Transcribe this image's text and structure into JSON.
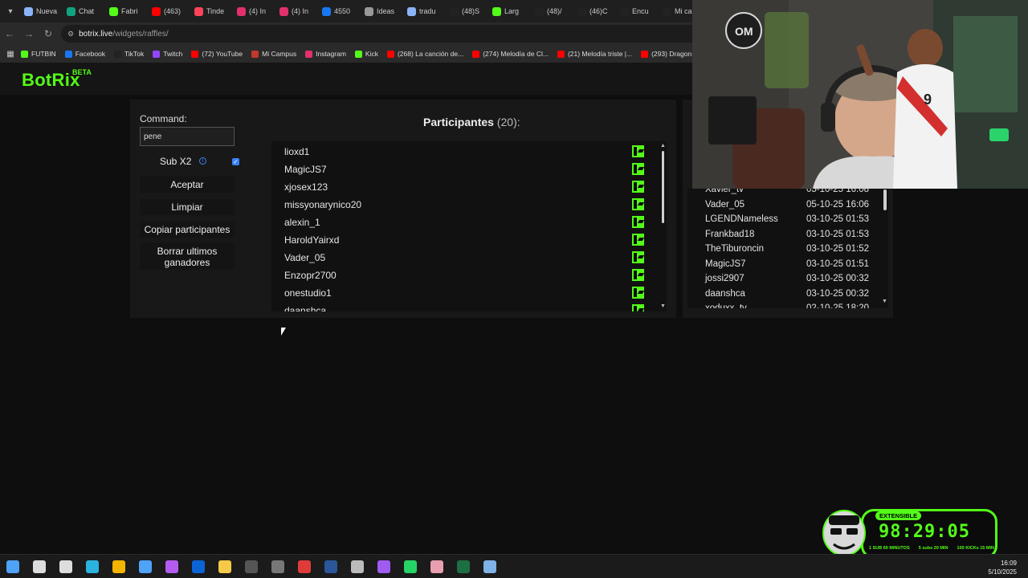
{
  "browser": {
    "tabs": [
      {
        "label": "Nueva",
        "color": "#8ab4f8"
      },
      {
        "label": "Chat",
        "color": "#10a37f"
      },
      {
        "label": "Fabri",
        "color": "#53fc18"
      },
      {
        "label": "(463)",
        "color": "#ff0000"
      },
      {
        "label": "Tinde",
        "color": "#ff4458"
      },
      {
        "label": "(4) In",
        "color": "#e1306c"
      },
      {
        "label": "(4) In",
        "color": "#e1306c"
      },
      {
        "label": "4550",
        "color": "#1877f2"
      },
      {
        "label": "Ideas",
        "color": "#999999"
      },
      {
        "label": "tradu",
        "color": "#8ab4f8"
      },
      {
        "label": "(48)S",
        "color": "#222222"
      },
      {
        "label": "Larg",
        "color": "#53fc18"
      },
      {
        "label": "(48)/",
        "color": "#222222"
      },
      {
        "label": "(46)C",
        "color": "#222222"
      },
      {
        "label": "Encu",
        "color": "#222222"
      },
      {
        "label": "Mi ca",
        "color": "#222222"
      },
      {
        "label": "(4",
        "color": "#e1306c"
      }
    ],
    "url_host": "botrix.live",
    "url_path": "/widgets/raffles/",
    "bookmarks": [
      {
        "label": "FUTBIN",
        "color": "#53fc18"
      },
      {
        "label": "Facebook",
        "color": "#1877f2"
      },
      {
        "label": "TikTok",
        "color": "#222222"
      },
      {
        "label": "Twitch",
        "color": "#9146ff"
      },
      {
        "label": "(72) YouTube",
        "color": "#ff0000"
      },
      {
        "label": "Mi Campus",
        "color": "#c0392b"
      },
      {
        "label": "Instagram",
        "color": "#e1306c"
      },
      {
        "label": "Kick",
        "color": "#53fc18"
      },
      {
        "label": "(268) La canción de...",
        "color": "#ff0000"
      },
      {
        "label": "(274) Melodía de Cl...",
        "color": "#ff0000"
      },
      {
        "label": "(21) Melodía triste |...",
        "color": "#ff0000"
      },
      {
        "label": "(293) Dragon Ba",
        "color": "#ff0000"
      }
    ]
  },
  "botrix": {
    "logo": "BotRix",
    "beta": "BETA",
    "command_label": "Command:",
    "command_value": "pene",
    "sub_x2_label": "Sub X2",
    "sub_x2_checked": true,
    "buttons": {
      "accept": "Aceptar",
      "clear": "Limpiar",
      "copy": "Copiar participantes",
      "delete_winners": "Borrar ultimos ganadores"
    },
    "participants_title": "Participantes",
    "participants_count": "(20):",
    "participants": [
      "lioxd1",
      "MagicJS7",
      "xjosex123",
      "missyonarynico20",
      "alexin_1",
      "HaroldYairxd",
      "Vader_05",
      "Enzopr2700",
      "onestudio1",
      "daanshca"
    ],
    "winners": [
      {
        "name": "Xavier_tv",
        "date": "05-10-25 16:08"
      },
      {
        "name": "Vader_05",
        "date": "05-10-25 16:06"
      },
      {
        "name": "LGENDNameless",
        "date": "03-10-25 01:53"
      },
      {
        "name": "Frankbad18",
        "date": "03-10-25 01:53"
      },
      {
        "name": "TheTiburoncin",
        "date": "03-10-25 01:52"
      },
      {
        "name": "MagicJS7",
        "date": "03-10-25 01:51"
      },
      {
        "name": "jossi2907",
        "date": "03-10-25 00:32"
      },
      {
        "name": "daanshca",
        "date": "03-10-25 00:32"
      },
      {
        "name": "xoduxx_tv",
        "date": "02-10-25 18:20"
      }
    ]
  },
  "stream_timer": {
    "badge": "EXTENSIBLE",
    "time": "98:29:05",
    "info": [
      "1 SUB 60 MINUTOS",
      "5 subs 20 MIN",
      "100 KICKs 15 MIN"
    ]
  },
  "taskbar": {
    "time": "16:09",
    "date": "5/10/2025",
    "icons": [
      {
        "name": "windows-start-icon",
        "color": "#4fa3f7"
      },
      {
        "name": "search-icon",
        "color": "#dddddd"
      },
      {
        "name": "task-view-icon",
        "color": "#dddddd"
      },
      {
        "name": "edge-icon",
        "color": "#2bb3e0"
      },
      {
        "name": "chrome-icon",
        "color": "#f4b400"
      },
      {
        "name": "store-icon",
        "color": "#4fa3f7"
      },
      {
        "name": "copilot-icon",
        "color": "#b45cf0"
      },
      {
        "name": "outlook-icon",
        "color": "#0a64d6"
      },
      {
        "name": "explorer-icon",
        "color": "#f7c948"
      },
      {
        "name": "obs-icon",
        "color": "#555555"
      },
      {
        "name": "app-icon",
        "color": "#777777"
      },
      {
        "name": "app-red-icon",
        "color": "#e03b3b"
      },
      {
        "name": "word-icon",
        "color": "#2b579a"
      },
      {
        "name": "logitech-icon",
        "color": "#bbbbbb"
      },
      {
        "name": "messenger-icon",
        "color": "#a05cf0"
      },
      {
        "name": "whatsapp-icon",
        "color": "#25d366"
      },
      {
        "name": "app-pink-icon",
        "color": "#e8a0b0"
      },
      {
        "name": "excel-icon",
        "color": "#1d6f42"
      },
      {
        "name": "notepad-icon",
        "color": "#7fb2e6"
      }
    ]
  }
}
